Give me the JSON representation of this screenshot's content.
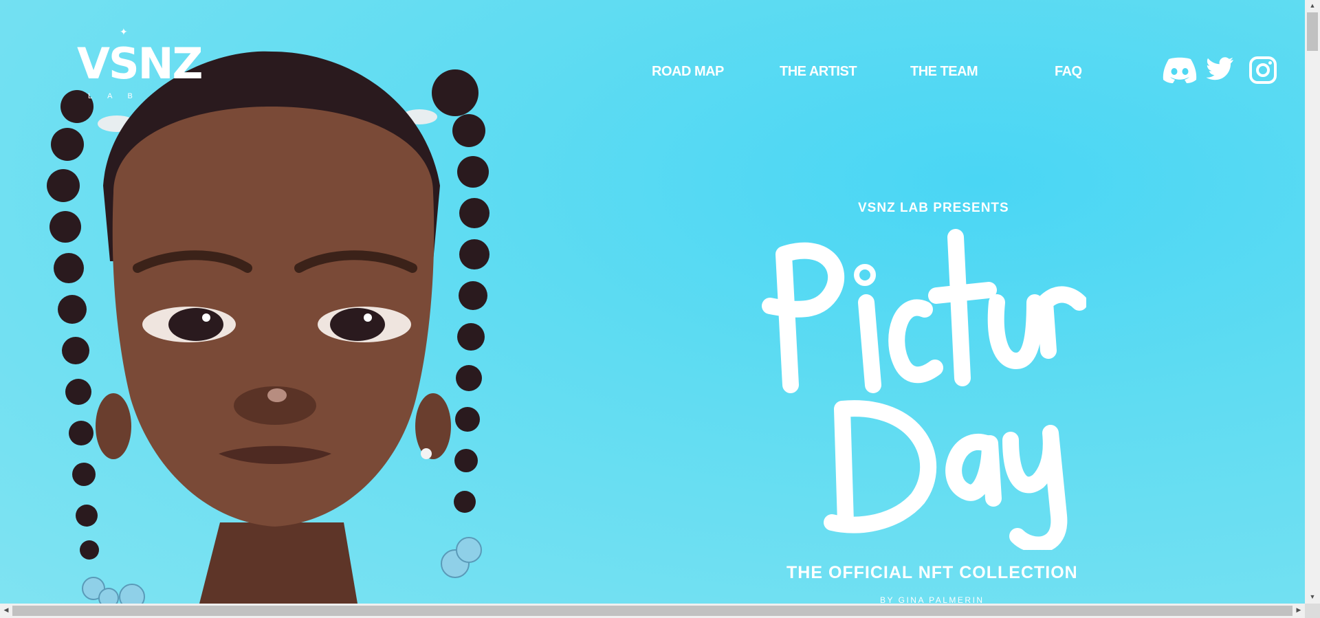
{
  "logo": {
    "word": "VSNZ",
    "sub": "LAB",
    "star": "✦"
  },
  "nav": {
    "items": [
      {
        "label": "ROAD MAP"
      },
      {
        "label": "THE ARTIST"
      },
      {
        "label": "THE TEAM"
      },
      {
        "label": "FAQ"
      }
    ]
  },
  "social": {
    "icons": [
      "discord-icon",
      "twitter-icon",
      "instagram-icon"
    ]
  },
  "hero": {
    "presents": "VSNZ LAB PRESENTS",
    "title_line1": "Picture",
    "title_line2": "Day",
    "subtitle": "THE OFFICIAL NFT COLLECTION",
    "byline": "BY GINA PALMERIN"
  },
  "colors": {
    "background": "#5fdcf1",
    "text": "#ffffff",
    "skin": "#7a4a37",
    "hair": "#2a1a1e"
  }
}
